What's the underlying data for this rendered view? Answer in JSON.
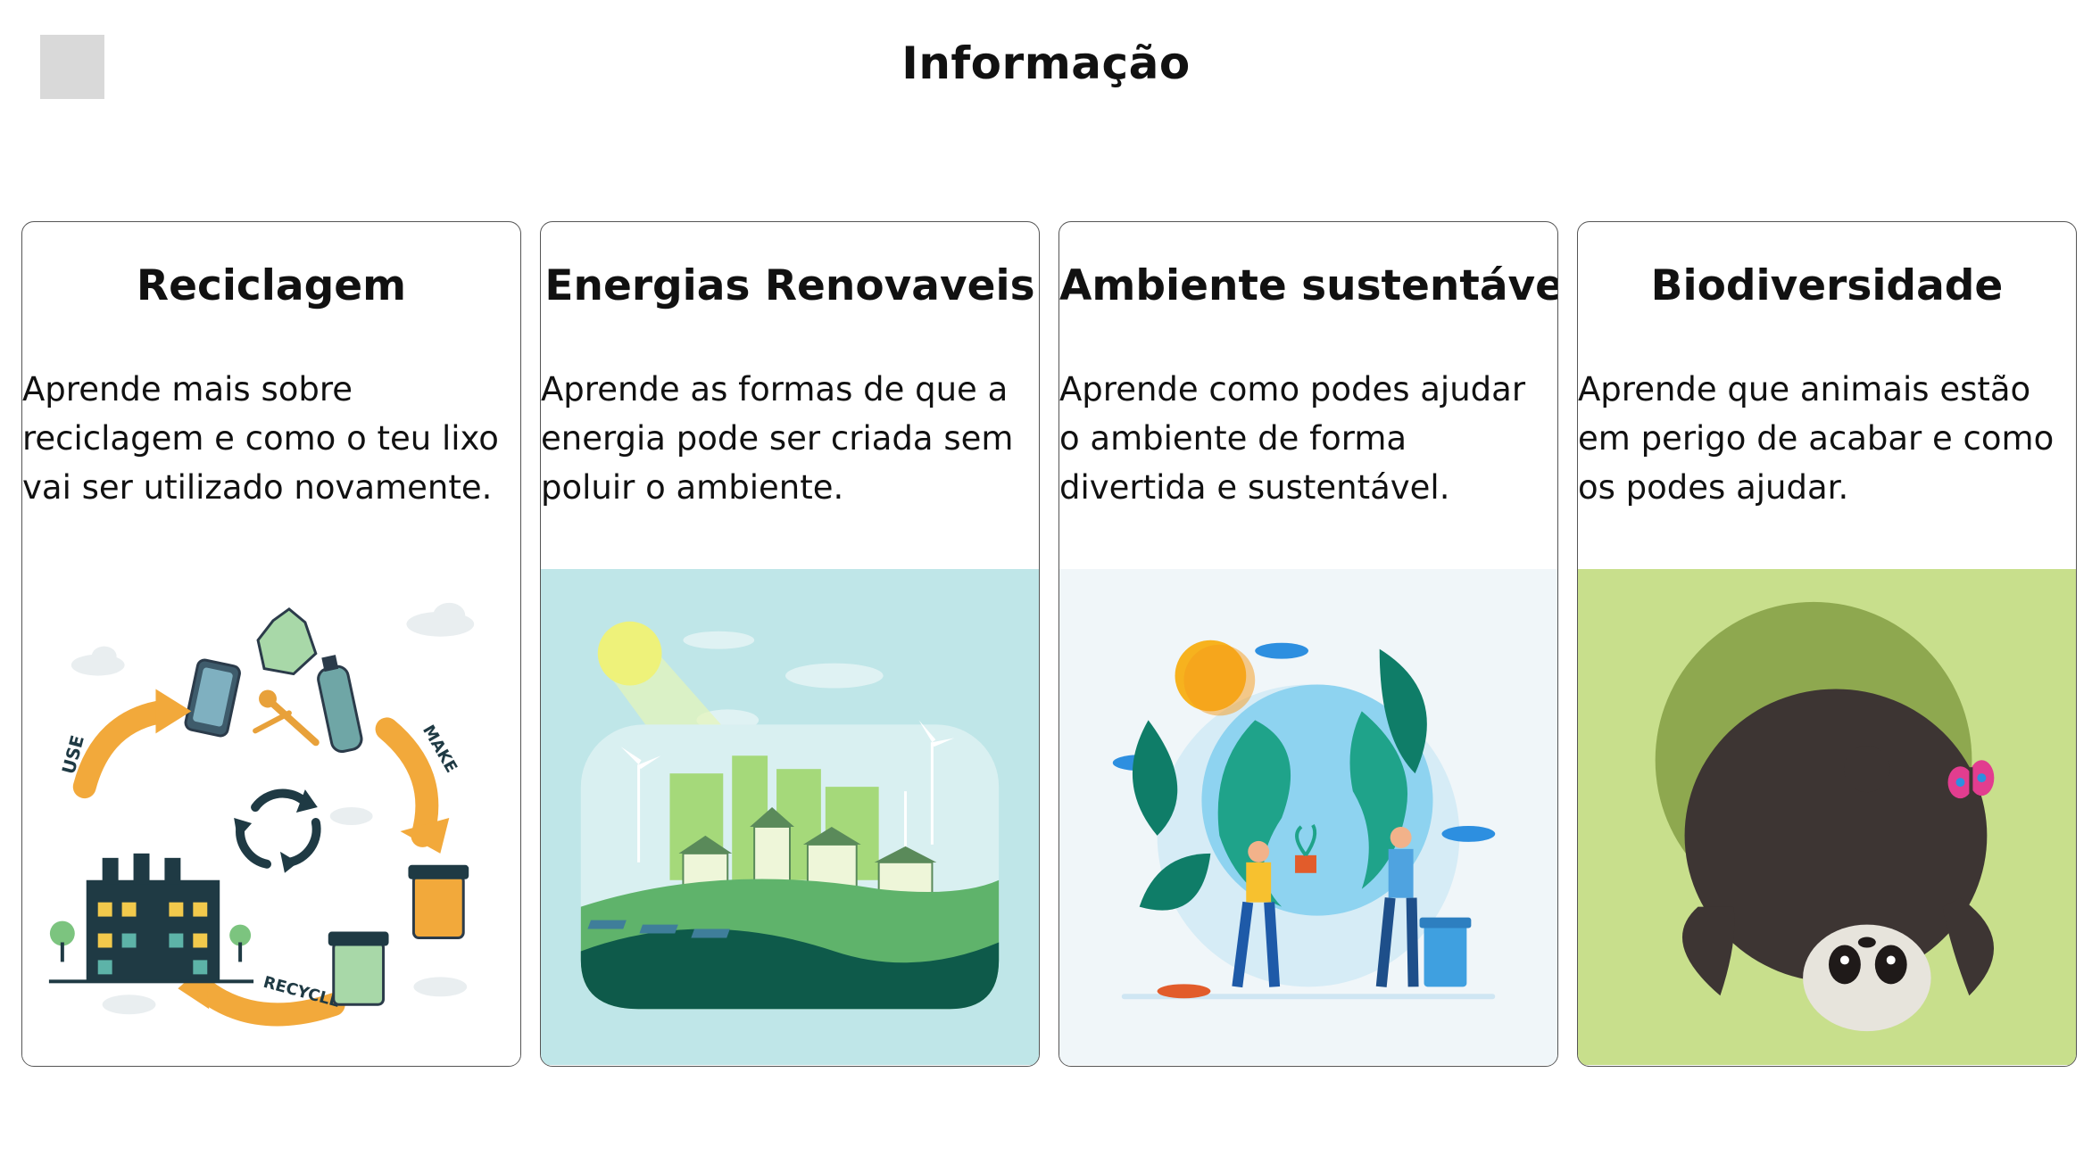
{
  "header": {
    "back_button": "back-button",
    "title": "Informação"
  },
  "cards": [
    {
      "title": "Reciclagem",
      "text": "Aprende mais sobre reciclagem e como o teu lixo vai ser utilizado novamente.",
      "image": "recycling-illustration",
      "image_bg": "#ffffff"
    },
    {
      "title": "Energias Renovaveis",
      "text": "Aprende as formas de que a energia pode ser criada sem poluir o ambiente.",
      "image": "renewable-energy-illustration",
      "image_bg": "#bfe6e8"
    },
    {
      "title": "Ambiente sustentável",
      "text": "Aprende como podes ajudar o ambiente de forma divertida e sustentável.",
      "image": "sustainable-environment-illustration",
      "image_bg": "#f0f6f9"
    },
    {
      "title": "Biodiversidade",
      "text": "Aprende que animais estão em perigo de acabar e como os podes ajudar.",
      "image": "panda-illustration",
      "image_bg": "#c8df8c"
    }
  ],
  "illustration_labels": {
    "use": "USE",
    "make": "MAKE",
    "recycle": "RECYCLE"
  }
}
